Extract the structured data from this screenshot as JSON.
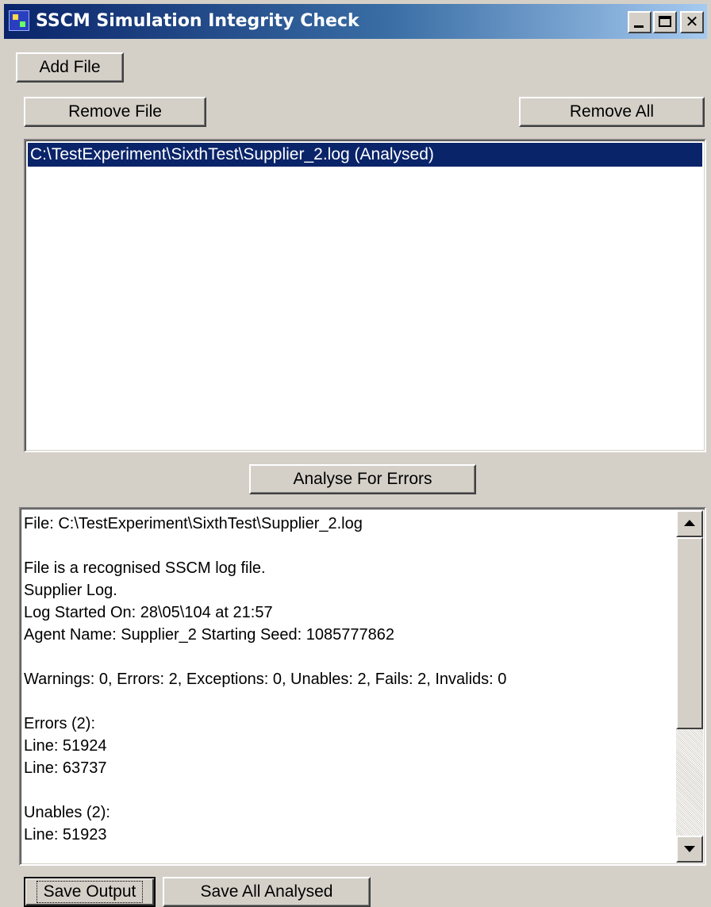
{
  "window": {
    "title": "SSCM Simulation Integrity Check",
    "icon": "app-grid-icon"
  },
  "toolbar": {
    "add_file": "Add File",
    "remove_file": "Remove File",
    "remove_all": "Remove All",
    "analyse": "Analyse For Errors"
  },
  "file_list": {
    "items": [
      {
        "label": "C:\\TestExperiment\\SixthTest\\Supplier_2.log (Analysed)",
        "selected": true
      }
    ]
  },
  "output": {
    "lines": [
      "File: C:\\TestExperiment\\SixthTest\\Supplier_2.log",
      "",
      "File is a recognised SSCM log file.",
      "Supplier Log.",
      "Log Started On: 28\\05\\104 at 21:57",
      "Agent Name: Supplier_2 Starting Seed: 1085777862",
      "",
      "Warnings: 0, Errors: 2, Exceptions: 0, Unables: 2, Fails: 2, Invalids: 0",
      "",
      "Errors (2):",
      "Line: 51924",
      "Line: 63737",
      "",
      "Unables (2):",
      "Line: 51923"
    ]
  },
  "footer": {
    "save_output": "Save Output",
    "save_all": "Save All Analysed"
  },
  "colors": {
    "selection": "#0a246a",
    "face": "#d4d0c8"
  }
}
